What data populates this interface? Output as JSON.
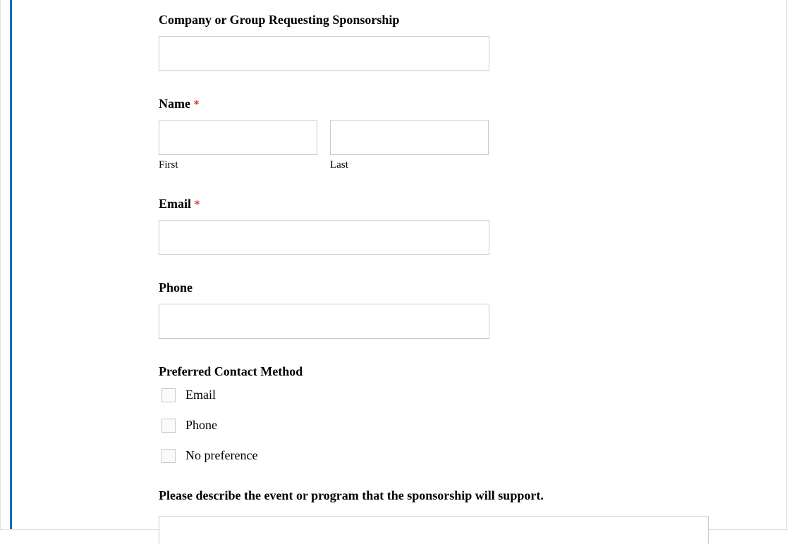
{
  "fields": {
    "company": {
      "label": "Company or Group Requesting Sponsorship"
    },
    "name": {
      "label": "Name",
      "required": "*",
      "first_sublabel": "First",
      "last_sublabel": "Last"
    },
    "email": {
      "label": "Email",
      "required": "*"
    },
    "phone": {
      "label": "Phone"
    },
    "contact_method": {
      "label": "Preferred Contact Method",
      "options": {
        "opt1": "Email",
        "opt2": "Phone",
        "opt3": "No preference"
      }
    },
    "describe": {
      "label": "Please describe the event or program that the sponsorship will support."
    }
  }
}
